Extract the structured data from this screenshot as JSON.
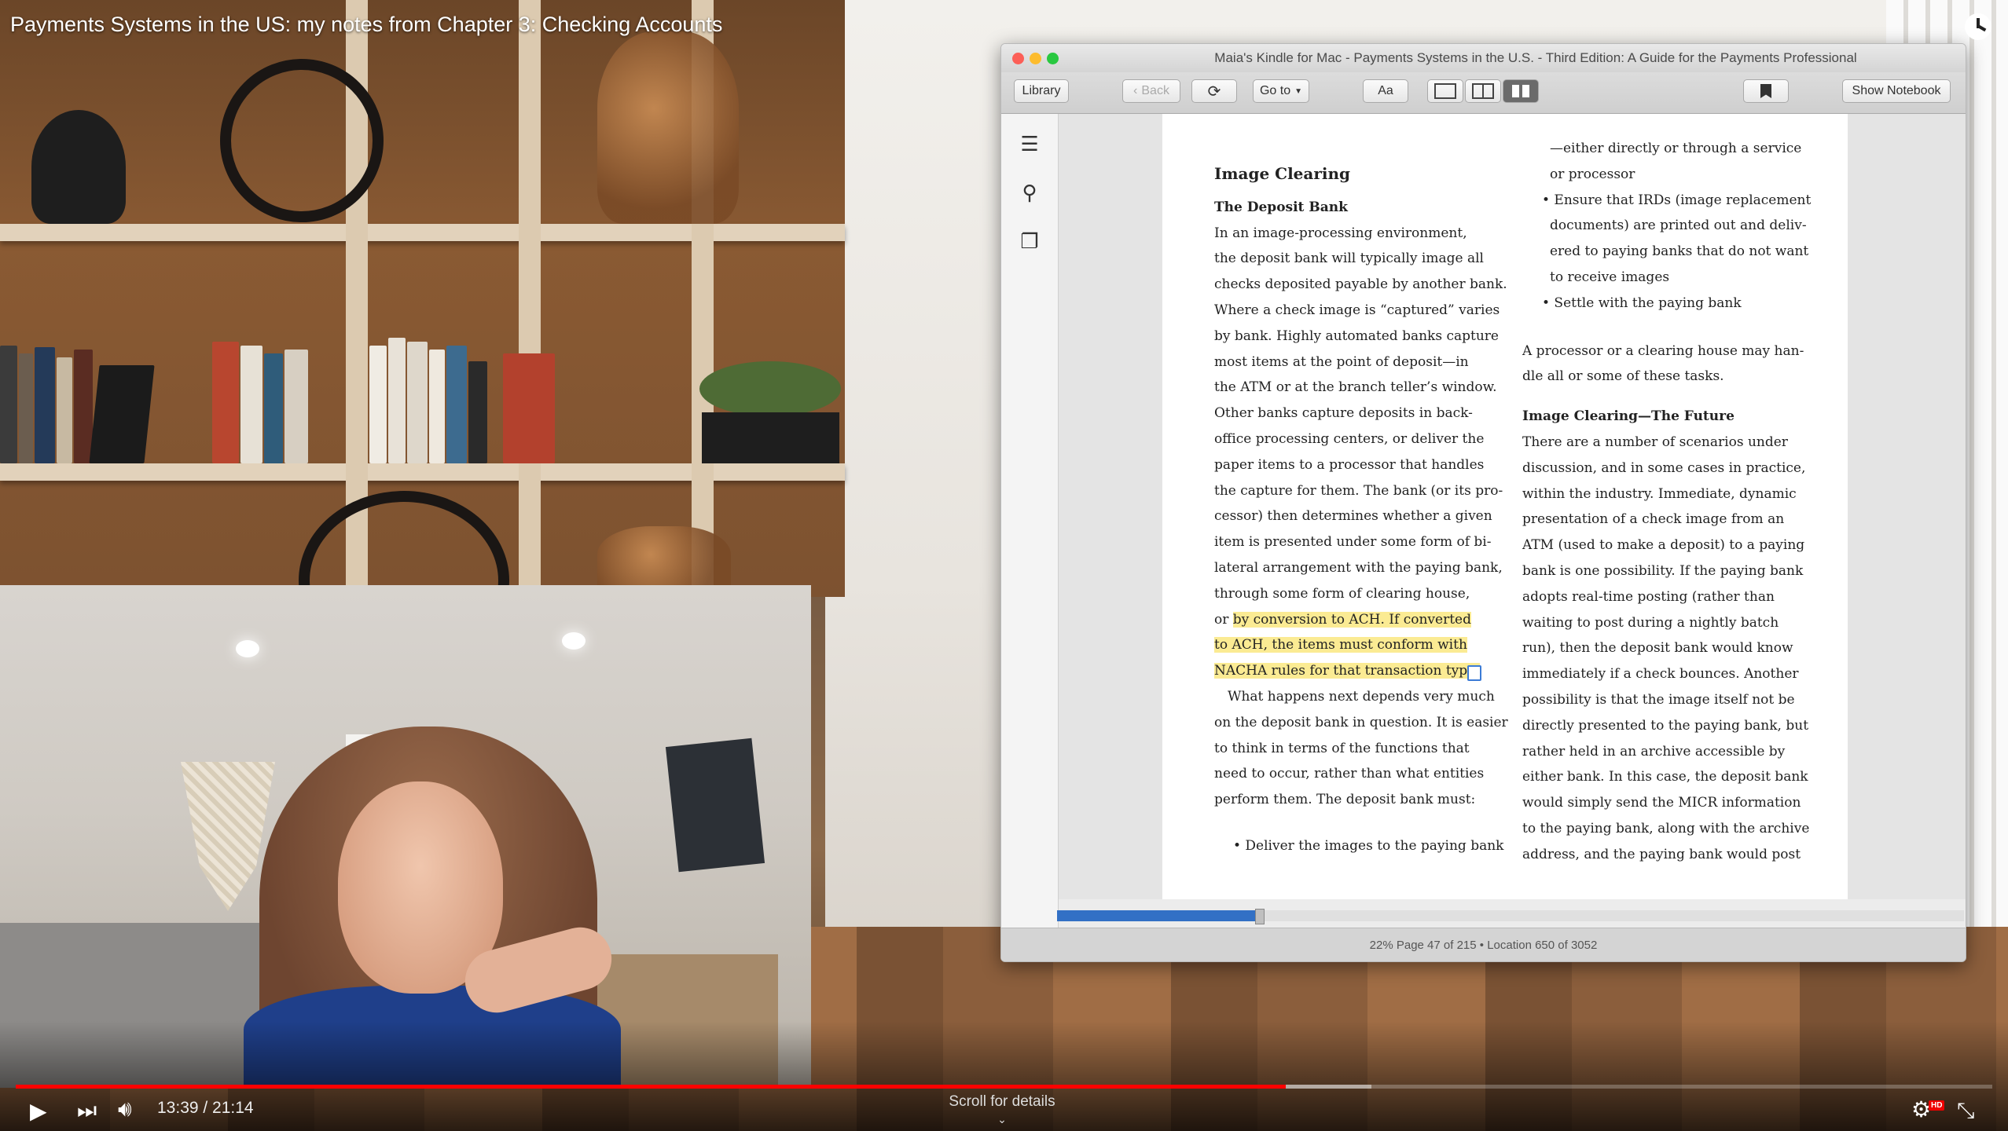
{
  "video": {
    "title": "Payments Systems in the US: my notes from Chapter 3: Checking Accounts",
    "time_display": "13:39 / 21:14",
    "scroll_hint": "Scroll for details",
    "scroll_hint_icon": "chevron-down-icon",
    "played_fraction": 0.6425,
    "buffered_fraction": 0.686,
    "accent_color": "#ff0000",
    "quality_badge": "HD"
  },
  "kindle": {
    "window_title": "Maia's Kindle for Mac - Payments Systems in the U.S. - Third Edition: A Guide for the Payments Professional",
    "toolbar": {
      "library": "Library",
      "back": "Back",
      "goto": "Go to",
      "font": "Aa",
      "show_notebook": "Show Notebook"
    },
    "left_column": {
      "heading": "Image Clearing",
      "subheading": "The Deposit Bank",
      "lines": [
        "In an image-processing environment,",
        "the deposit bank will typically image all",
        "checks deposited payable by another bank.",
        "Where a check image is “captured” varies",
        "by bank. Highly automated banks capture",
        "most items at the point of deposit—in",
        "the ATM or at the branch teller’s window.",
        "Other banks capture deposits in back-",
        "office processing centers, or deliver the",
        "paper items to a processor that handles",
        "the capture for them. The bank (or its pro-",
        "cessor) then determines whether a given",
        "item is presented under some form of bi-",
        "lateral arrangement with the paying bank,",
        "through some form of clearing house,"
      ],
      "hl_prefix": "or ",
      "hl_line1": "by conversion to ACH. If converted",
      "hl_line2": "to ACH, the items must conform with",
      "hl_line3": "NACHA rules for that transaction type.",
      "lines_after": [
        " What happens next depends very much",
        "on the deposit bank in question. It is easier",
        "to think in terms of the functions that",
        "need to occur, rather than what entities",
        "perform them. The deposit bank must:"
      ],
      "bullet": "• Deliver the images to the paying bank"
    },
    "right_column": {
      "lines_top": [
        "—either directly or through a service",
        "or processor",
        "• Ensure that IRDs (image replacement",
        "documents) are printed out and deliv-",
        "ered to paying banks that do not want",
        "to receive images",
        "• Settle with the paying bank"
      ],
      "para": [
        "A processor or a clearing house may han-",
        "dle all or some of these tasks."
      ],
      "subheading": "Image Clearing—The Future",
      "lines": [
        "There are a number of scenarios under",
        "discussion, and in some cases in practice,",
        "within the industry. Immediate, dynamic",
        "presentation of a check image from an",
        "ATM (used to make a deposit) to a paying",
        "bank is one possibility. If the paying bank",
        "adopts real-time posting (rather than",
        "waiting to post during a nightly batch",
        "run), then the deposit bank would know",
        "immediately if a check bounces. Another",
        "possibility is that the image itself not be",
        "directly presented to the paying bank, but",
        "rather held in an archive accessible by",
        "either bank. In this case, the deposit bank",
        "would simply send the MICR information",
        "to the paying bank, along with the archive",
        "address, and the paying bank would post"
      ]
    },
    "reading_progress_fraction": 0.22,
    "status": "22%   Page 47 of 215  •  Location 650 of 3052",
    "highlight_color": "#fbeb93",
    "progress_color": "#3270c5"
  }
}
